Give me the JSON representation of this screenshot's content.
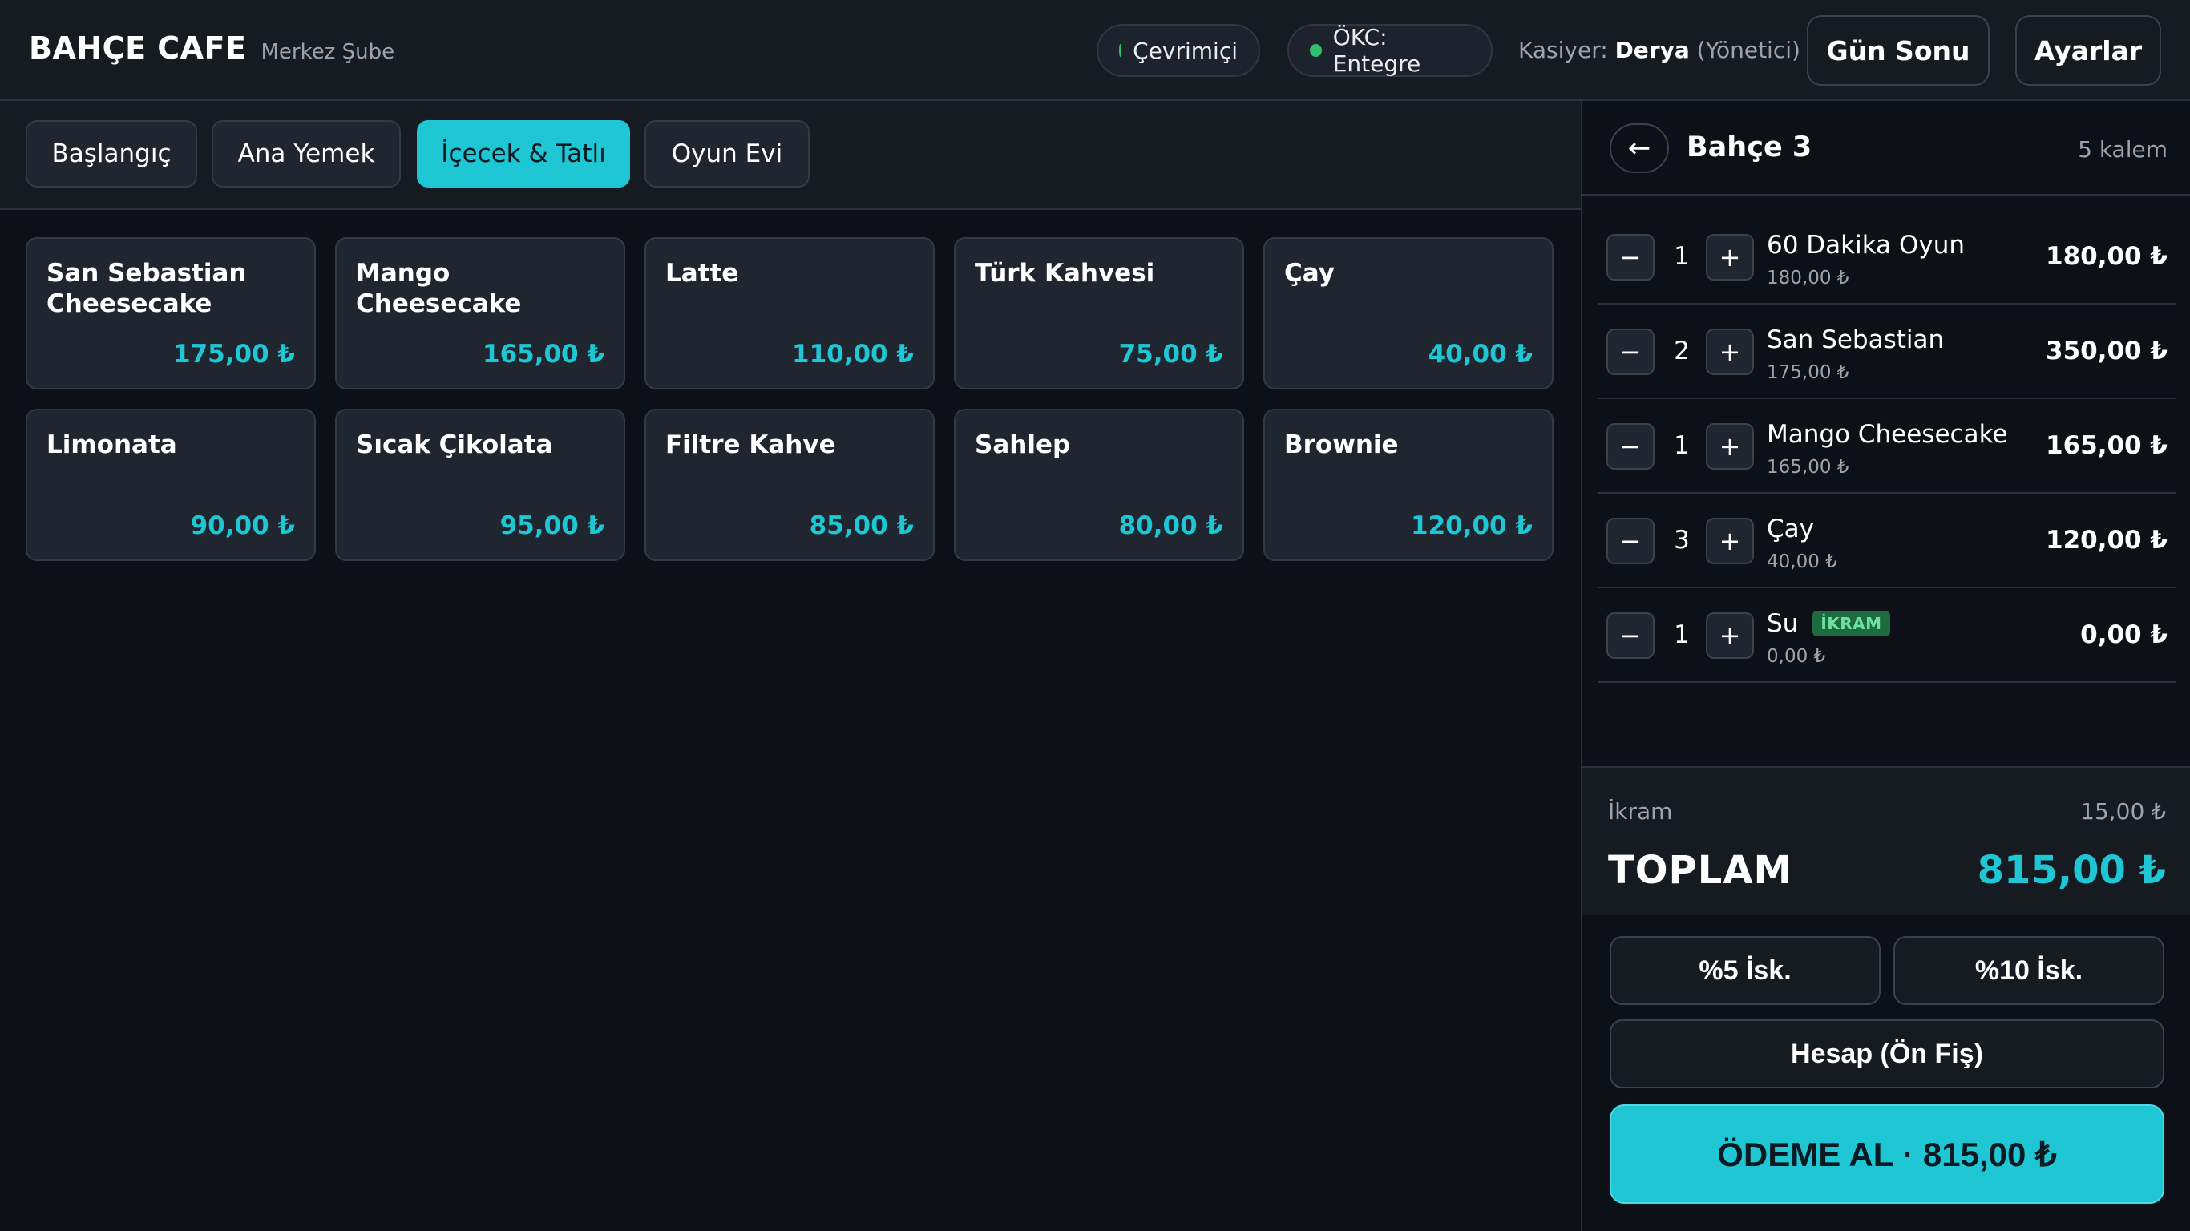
{
  "header": {
    "brand_name": "BAHÇE CAFE",
    "branch": "Merkez Şube",
    "status_online": "Çevrimiçi",
    "status_okc": "ÖKC: Entegre",
    "cashier_label": "Kasiyer:",
    "cashier_name": "Derya",
    "cashier_role": "(Yönetici)",
    "day_end_button": "Gün Sonu",
    "settings_button": "Ayarlar"
  },
  "tabs": [
    {
      "label": "Başlangıç",
      "active": false
    },
    {
      "label": "Ana Yemek",
      "active": false
    },
    {
      "label": "İçecek & Tatlı",
      "active": true
    },
    {
      "label": "Oyun Evi",
      "active": false
    }
  ],
  "products": [
    {
      "name": "San Sebastian Cheesecake",
      "price": "175,00 ₺"
    },
    {
      "name": "Mango Cheesecake",
      "price": "165,00 ₺"
    },
    {
      "name": "Latte",
      "price": "110,00 ₺"
    },
    {
      "name": "Türk Kahvesi",
      "price": "75,00 ₺"
    },
    {
      "name": "Çay",
      "price": "40,00 ₺"
    },
    {
      "name": "Limonata",
      "price": "90,00 ₺"
    },
    {
      "name": "Sıcak Çikolata",
      "price": "95,00 ₺"
    },
    {
      "name": "Filtre Kahve",
      "price": "85,00 ₺"
    },
    {
      "name": "Sahlep",
      "price": "80,00 ₺"
    },
    {
      "name": "Brownie",
      "price": "120,00 ₺"
    }
  ],
  "order": {
    "back_icon": "←",
    "table_name": "Bahçe 3",
    "item_count": "5 kalem",
    "items": [
      {
        "qty": "1",
        "name": "60 Dakika Oyun",
        "unit_price": "180,00 ₺",
        "total": "180,00 ₺",
        "badge": ""
      },
      {
        "qty": "2",
        "name": "San Sebastian",
        "unit_price": "175,00 ₺",
        "total": "350,00 ₺",
        "badge": ""
      },
      {
        "qty": "1",
        "name": "Mango Cheesecake",
        "unit_price": "165,00 ₺",
        "total": "165,00 ₺",
        "badge": ""
      },
      {
        "qty": "3",
        "name": "Çay",
        "unit_price": "40,00 ₺",
        "total": "120,00 ₺",
        "badge": ""
      },
      {
        "qty": "1",
        "name": "Su",
        "unit_price": "0,00 ₺",
        "total": "0,00 ₺",
        "badge": "İKRAM"
      }
    ],
    "minus_symbol": "−",
    "plus_symbol": "+"
  },
  "summary": {
    "ikram_label": "İkram",
    "ikram_value": "15,00 ₺",
    "total_label": "TOPLAM",
    "total_value": "815,00 ₺"
  },
  "actions": {
    "discount5": "%5 İsk.",
    "discount10": "%10 İsk.",
    "pre_receipt": "Hesap (Ön Fiş)",
    "pay": "ÖDEME AL · 815,00 ₺"
  },
  "colors": {
    "accent": "#1fc6d3",
    "status_green": "#2fbf71",
    "background": "#0d1117",
    "panel": "#161b22"
  }
}
